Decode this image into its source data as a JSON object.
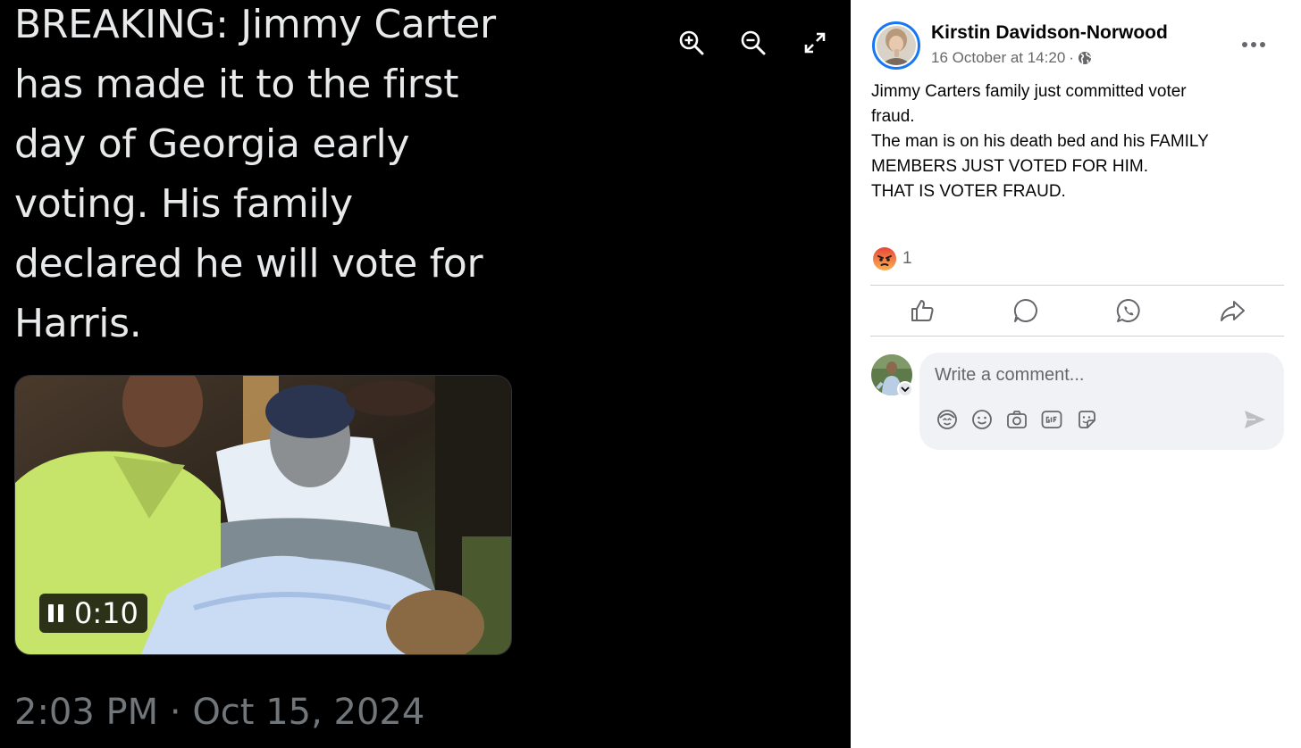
{
  "tweet": {
    "text": "BREAKING: Jimmy Carter has made it to the first day of Georgia early voting. His family declared he will vote for Harris.",
    "video_time": "0:10",
    "timestamp": "2:03 PM · Oct 15, 2024"
  },
  "viewer": {
    "icons": [
      "zoom-in-icon",
      "zoom-out-icon",
      "fullscreen-icon"
    ]
  },
  "post": {
    "author": "Kirstin Davidson-Norwood",
    "date": "16 October at 14:20",
    "separator": "·",
    "body_lines": [
      "Jimmy Carters family just committed voter",
      "fraud.",
      "The man is on his death bed and his FAMILY",
      "MEMBERS JUST VOTED FOR HIM.",
      "THAT IS VOTER FRAUD."
    ],
    "reaction_count": "1",
    "reaction_type": "angry-reaction-icon",
    "actions": [
      "like-icon",
      "comment-icon",
      "whatsapp-icon",
      "share-icon"
    ]
  },
  "comment": {
    "placeholder": "Write a comment...",
    "tools": [
      "avatar-sticker-icon",
      "emoji-icon",
      "camera-icon",
      "gif-icon",
      "sticker-icon"
    ]
  },
  "colors": {
    "viewer_bg": "#000000",
    "tweet_text": "#e7e9ea",
    "timestamp": "#71767b",
    "accent": "#1877f2",
    "angry": "#f0653b"
  }
}
